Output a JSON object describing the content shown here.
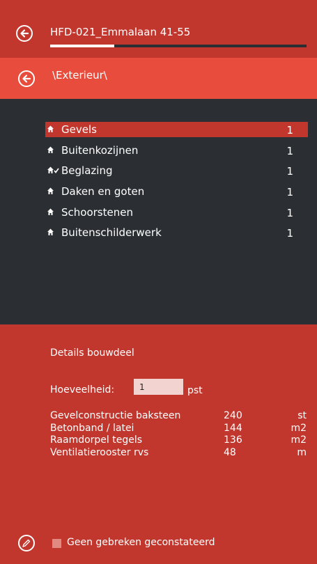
{
  "header": {
    "project_title": "HFD-021_Emmalaan 41-55",
    "progress_fraction": 0.25,
    "back_icon": "arrow-left-icon"
  },
  "subheader": {
    "breadcrumb": "\\Exterieur\\",
    "back_icon": "arrow-left-icon"
  },
  "list": {
    "items": [
      {
        "label": "Gevels",
        "count": "1",
        "icon": "house-icon",
        "selected": true
      },
      {
        "label": "Buitenkozijnen",
        "count": "1",
        "icon": "house-icon",
        "selected": false
      },
      {
        "label": "Beglazing",
        "count": "1",
        "icon": "house-check-icon",
        "selected": false
      },
      {
        "label": "Daken en goten",
        "count": "1",
        "icon": "house-icon",
        "selected": false
      },
      {
        "label": "Schoorstenen",
        "count": "1",
        "icon": "house-icon",
        "selected": false
      },
      {
        "label": "Buitenschilderwerk",
        "count": "1",
        "icon": "house-icon",
        "selected": false
      }
    ]
  },
  "details": {
    "title": "Details bouwdeel",
    "quantity_label": "Hoeveelheid:",
    "quantity_value": "1",
    "quantity_unit": "pst",
    "materials": [
      {
        "name": "Gevelconstructie baksteen",
        "value": "240",
        "unit": "st"
      },
      {
        "name": "Betonband / latei",
        "value": "144",
        "unit": "m2"
      },
      {
        "name": "Raamdorpel tegels",
        "value": "136",
        "unit": "m2"
      },
      {
        "name": "Ventilatierooster rvs",
        "value": "48",
        "unit": "m"
      }
    ],
    "no_defects_label": "Geen gebreken geconstateerd",
    "no_defects_checked": false,
    "edit_icon": "pencil-icon"
  },
  "colors": {
    "header_red": "#c1372d",
    "accent_red": "#e74c3c",
    "panel_dark": "#2b2f33",
    "input_bg": "#f3d3d0"
  }
}
